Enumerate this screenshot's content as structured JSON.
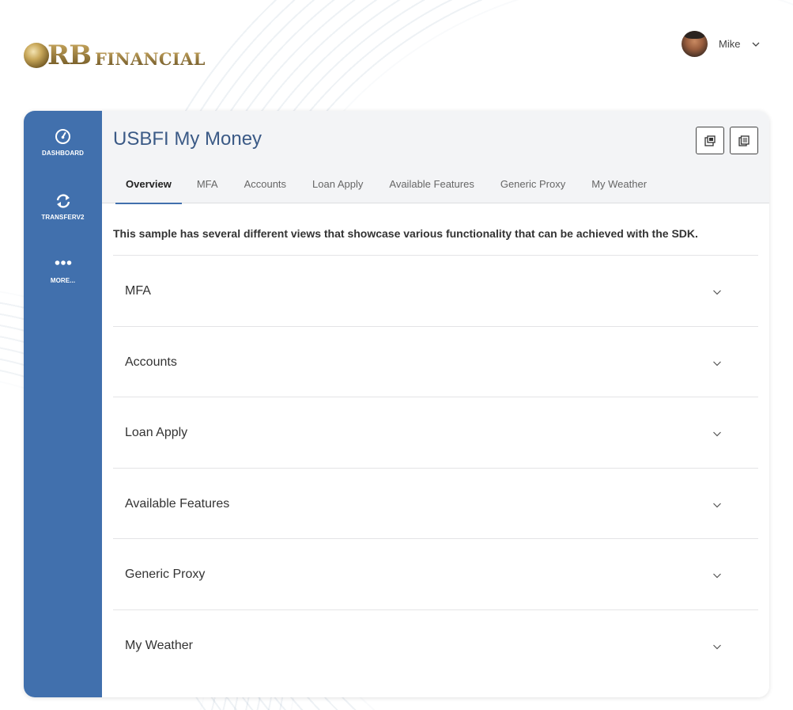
{
  "brand": {
    "logo_rb": "RB",
    "logo_financial": "FINANCIAL",
    "gold": "#8a6f35"
  },
  "user": {
    "name": "Mike",
    "avatar_icon": "user-avatar",
    "menu_icon": "chevron-down-icon"
  },
  "sidebar": {
    "color": "#4170ad",
    "items": [
      {
        "label": "DASHBOARD",
        "icon": "speedometer-icon"
      },
      {
        "label": "TRANSFERV2",
        "icon": "refresh-arrows-icon"
      },
      {
        "label": "MORE...",
        "icon": "more-dots-icon"
      }
    ]
  },
  "page": {
    "title": "USBFI My Money",
    "actions": [
      {
        "icon": "popout-window-icon"
      },
      {
        "icon": "document-list-icon"
      }
    ]
  },
  "tabs": [
    {
      "label": "Overview",
      "active": true
    },
    {
      "label": "MFA"
    },
    {
      "label": "Accounts"
    },
    {
      "label": "Loan Apply"
    },
    {
      "label": "Available Features"
    },
    {
      "label": "Generic Proxy"
    },
    {
      "label": "My Weather"
    }
  ],
  "intro": "This sample has several different views that showcase various functionality that can be achieved with the SDK.",
  "accordion": [
    {
      "label": "MFA"
    },
    {
      "label": "Accounts"
    },
    {
      "label": "Loan Apply"
    },
    {
      "label": "Available Features"
    },
    {
      "label": "Generic Proxy"
    },
    {
      "label": "My Weather"
    }
  ]
}
